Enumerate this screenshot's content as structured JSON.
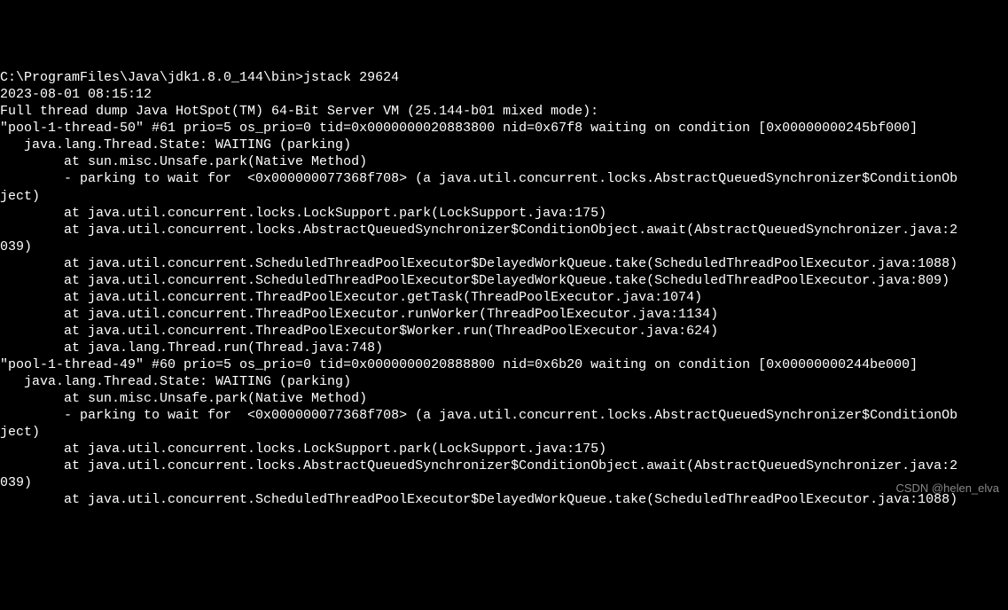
{
  "terminal": {
    "lines": [
      "C:\\ProgramFiles\\Java\\jdk1.8.0_144\\bin>jstack 29624",
      "2023-08-01 08:15:12",
      "Full thread dump Java HotSpot(TM) 64-Bit Server VM (25.144-b01 mixed mode):",
      "",
      "\"pool-1-thread-50\" #61 prio=5 os_prio=0 tid=0x0000000020883800 nid=0x67f8 waiting on condition [0x00000000245bf000]",
      "   java.lang.Thread.State: WAITING (parking)",
      "        at sun.misc.Unsafe.park(Native Method)",
      "        - parking to wait for  <0x000000077368f708> (a java.util.concurrent.locks.AbstractQueuedSynchronizer$ConditionOb",
      "ject)",
      "        at java.util.concurrent.locks.LockSupport.park(LockSupport.java:175)",
      "        at java.util.concurrent.locks.AbstractQueuedSynchronizer$ConditionObject.await(AbstractQueuedSynchronizer.java:2",
      "039)",
      "        at java.util.concurrent.ScheduledThreadPoolExecutor$DelayedWorkQueue.take(ScheduledThreadPoolExecutor.java:1088)",
      "",
      "        at java.util.concurrent.ScheduledThreadPoolExecutor$DelayedWorkQueue.take(ScheduledThreadPoolExecutor.java:809)",
      "        at java.util.concurrent.ThreadPoolExecutor.getTask(ThreadPoolExecutor.java:1074)",
      "        at java.util.concurrent.ThreadPoolExecutor.runWorker(ThreadPoolExecutor.java:1134)",
      "        at java.util.concurrent.ThreadPoolExecutor$Worker.run(ThreadPoolExecutor.java:624)",
      "        at java.lang.Thread.run(Thread.java:748)",
      "",
      "\"pool-1-thread-49\" #60 prio=5 os_prio=0 tid=0x0000000020888800 nid=0x6b20 waiting on condition [0x00000000244be000]",
      "   java.lang.Thread.State: WAITING (parking)",
      "        at sun.misc.Unsafe.park(Native Method)",
      "        - parking to wait for  <0x000000077368f708> (a java.util.concurrent.locks.AbstractQueuedSynchronizer$ConditionOb",
      "ject)",
      "        at java.util.concurrent.locks.LockSupport.park(LockSupport.java:175)",
      "        at java.util.concurrent.locks.AbstractQueuedSynchronizer$ConditionObject.await(AbstractQueuedSynchronizer.java:2",
      "039)",
      "        at java.util.concurrent.ScheduledThreadPoolExecutor$DelayedWorkQueue.take(ScheduledThreadPoolExecutor.java:1088)"
    ]
  },
  "watermark": "CSDN @helen_elva"
}
